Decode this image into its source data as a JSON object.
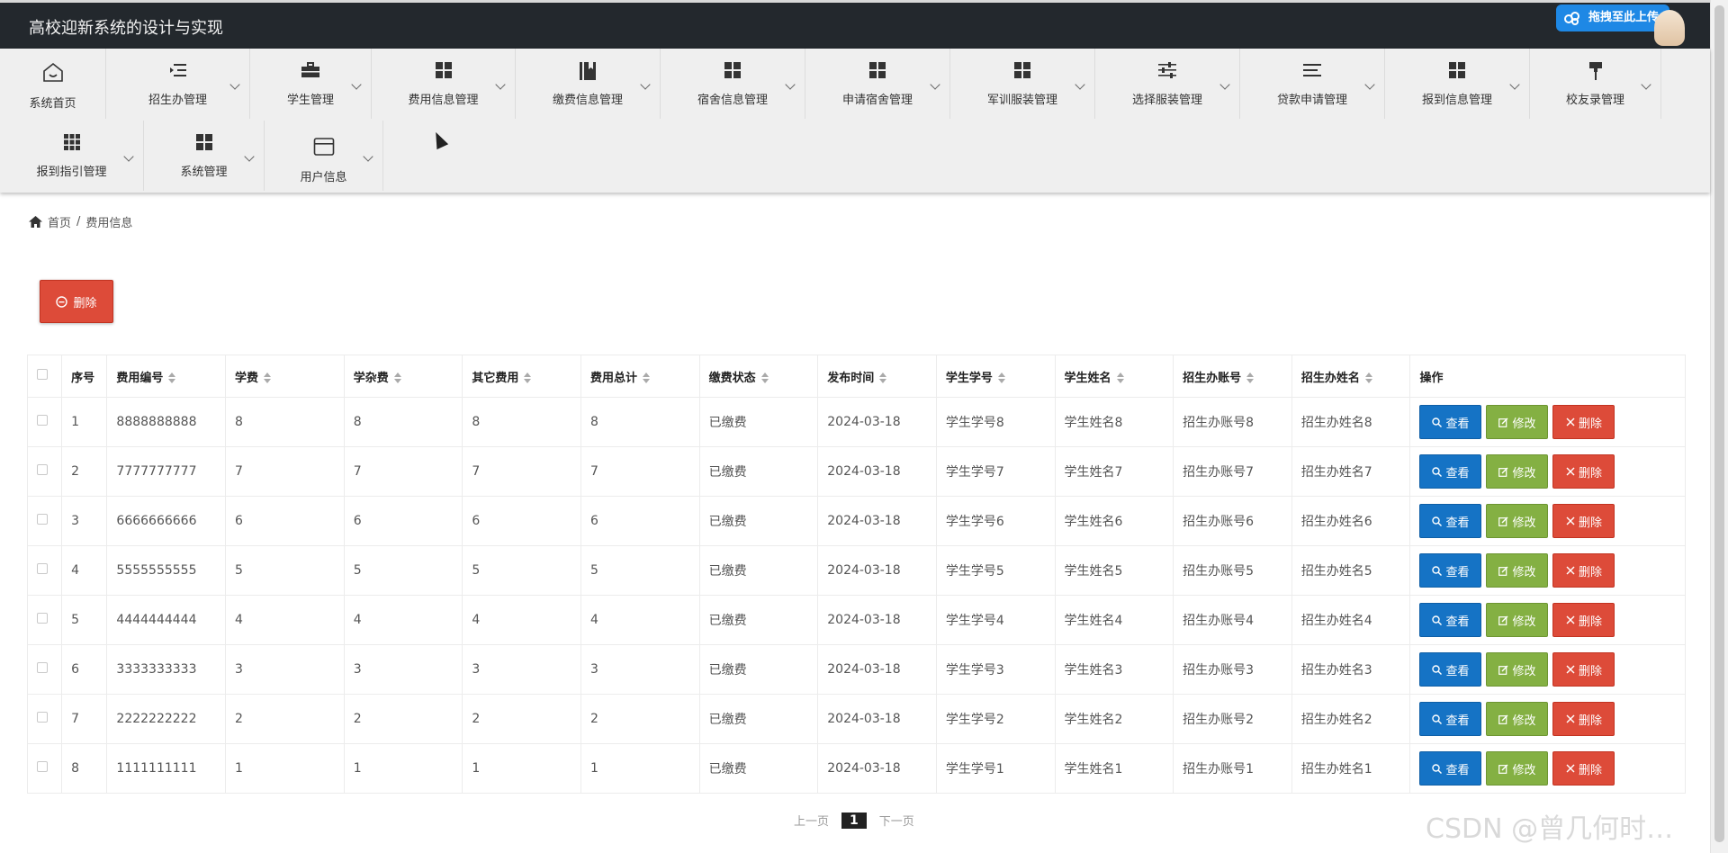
{
  "app": {
    "title": "高校迎新系统的设计与实现"
  },
  "upload_badge": "拖拽至此上传",
  "nav": {
    "items": [
      {
        "label": "系统首页",
        "icon": "home-icon"
      },
      {
        "label": "招生办管理",
        "icon": "list-indent-icon"
      },
      {
        "label": "学生管理",
        "icon": "briefcase-icon"
      },
      {
        "label": "费用信息管理",
        "icon": "grid-icon"
      },
      {
        "label": "缴费信息管理",
        "icon": "book-icon"
      },
      {
        "label": "宿舍信息管理",
        "icon": "grid-icon"
      },
      {
        "label": "申请宿舍管理",
        "icon": "grid-icon"
      },
      {
        "label": "军训服装管理",
        "icon": "grid-icon"
      },
      {
        "label": "选择服装管理",
        "icon": "sliders-icon"
      },
      {
        "label": "贷款申请管理",
        "icon": "list-lines-icon"
      },
      {
        "label": "报到信息管理",
        "icon": "grid-icon"
      },
      {
        "label": "校友录管理",
        "icon": "paint-roller-icon"
      },
      {
        "label": "报到指引管理",
        "icon": "grid-9-icon"
      },
      {
        "label": "系统管理",
        "icon": "grid-icon"
      },
      {
        "label": "用户信息",
        "icon": "card-icon"
      }
    ]
  },
  "breadcrumb": {
    "home": "首页",
    "separator": "/",
    "current": "费用信息"
  },
  "toolbar": {
    "delete_label": "删除"
  },
  "table": {
    "headers": [
      "序号",
      "费用编号",
      "学费",
      "学杂费",
      "其它费用",
      "费用总计",
      "缴费状态",
      "发布时间",
      "学生学号",
      "学生姓名",
      "招生办账号",
      "招生办姓名",
      "操作"
    ],
    "rows": [
      [
        "1",
        "8888888888",
        "8",
        "8",
        "8",
        "8",
        "已缴费",
        "2024-03-18",
        "学生学号8",
        "学生姓名8",
        "招生办账号8",
        "招生办姓名8"
      ],
      [
        "2",
        "7777777777",
        "7",
        "7",
        "7",
        "7",
        "已缴费",
        "2024-03-18",
        "学生学号7",
        "学生姓名7",
        "招生办账号7",
        "招生办姓名7"
      ],
      [
        "3",
        "6666666666",
        "6",
        "6",
        "6",
        "6",
        "已缴费",
        "2024-03-18",
        "学生学号6",
        "学生姓名6",
        "招生办账号6",
        "招生办姓名6"
      ],
      [
        "4",
        "5555555555",
        "5",
        "5",
        "5",
        "5",
        "已缴费",
        "2024-03-18",
        "学生学号5",
        "学生姓名5",
        "招生办账号5",
        "招生办姓名5"
      ],
      [
        "5",
        "4444444444",
        "4",
        "4",
        "4",
        "4",
        "已缴费",
        "2024-03-18",
        "学生学号4",
        "学生姓名4",
        "招生办账号4",
        "招生办姓名4"
      ],
      [
        "6",
        "3333333333",
        "3",
        "3",
        "3",
        "3",
        "已缴费",
        "2024-03-18",
        "学生学号3",
        "学生姓名3",
        "招生办账号3",
        "招生办姓名3"
      ],
      [
        "7",
        "2222222222",
        "2",
        "2",
        "2",
        "2",
        "已缴费",
        "2024-03-18",
        "学生学号2",
        "学生姓名2",
        "招生办账号2",
        "招生办姓名2"
      ],
      [
        "8",
        "1111111111",
        "1",
        "1",
        "1",
        "1",
        "已缴费",
        "2024-03-18",
        "学生学号1",
        "学生姓名1",
        "招生办账号1",
        "招生办姓名1"
      ]
    ],
    "actions": {
      "view": "查看",
      "edit": "修改",
      "delete": "删除"
    }
  },
  "pager": {
    "prev": "上一页",
    "current": "1",
    "next": "下一页"
  },
  "watermark": "CSDN @曾几何时…",
  "colors": {
    "header_bg": "#23282d",
    "primary": "#1573c5",
    "success": "#84b043",
    "danger": "#dd4b39"
  }
}
